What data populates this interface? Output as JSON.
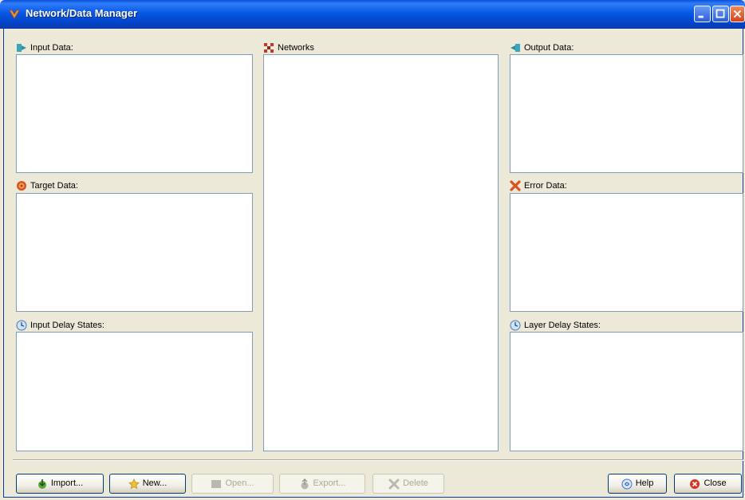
{
  "window": {
    "title": "Network/Data Manager"
  },
  "panels": {
    "input_data": {
      "label": "Input Data:",
      "icon": "input-data-icon"
    },
    "target_data": {
      "label": "Target Data:",
      "icon": "target-icon"
    },
    "input_delay_states": {
      "label": "Input Delay States:",
      "icon": "delay-clock-icon"
    },
    "networks": {
      "label": "Networks",
      "icon": "network-icon"
    },
    "output_data": {
      "label": "Output Data:",
      "icon": "output-data-icon"
    },
    "error_data": {
      "label": "Error Data:",
      "icon": "error-icon"
    },
    "layer_delay_states": {
      "label": "Layer Delay States:",
      "icon": "delay-clock-icon"
    }
  },
  "buttons": {
    "import": {
      "label": "Import...",
      "enabled": true
    },
    "new": {
      "label": "New...",
      "enabled": true
    },
    "open": {
      "label": "Open...",
      "enabled": false
    },
    "export": {
      "label": "Export...",
      "enabled": false
    },
    "delete": {
      "label": "Delete",
      "enabled": false
    },
    "help": {
      "label": "Help",
      "enabled": true
    },
    "close": {
      "label": "Close",
      "enabled": true
    }
  },
  "colors": {
    "titlebar": "#0758e4",
    "face": "#ece9d8",
    "list_border": "#7f9db9"
  }
}
